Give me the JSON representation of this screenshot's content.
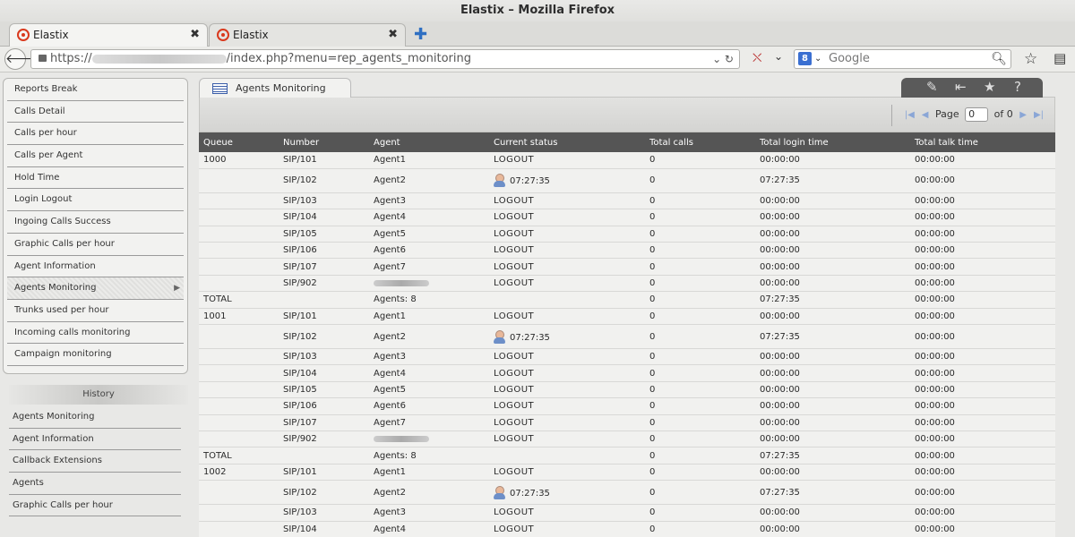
{
  "window": {
    "title": "Elastix – Mozilla Firefox"
  },
  "tabs": [
    {
      "label": "Elastix"
    },
    {
      "label": "Elastix"
    }
  ],
  "navbar": {
    "url_prefix": "https://",
    "url_suffix": "/index.php?menu=rep_agents_monitoring",
    "search_placeholder": "Google",
    "search_engine_letter": "8"
  },
  "sidebar": {
    "items": [
      {
        "label": "Reports Break"
      },
      {
        "label": "Calls Detail"
      },
      {
        "label": "Calls per hour"
      },
      {
        "label": "Calls per Agent"
      },
      {
        "label": "Hold Time"
      },
      {
        "label": "Login Logout"
      },
      {
        "label": "Ingoing Calls Success"
      },
      {
        "label": "Graphic Calls per hour"
      },
      {
        "label": "Agent Information"
      },
      {
        "label": "Agents Monitoring"
      },
      {
        "label": "Trunks used per hour"
      },
      {
        "label": "Incoming calls monitoring"
      },
      {
        "label": "Campaign monitoring"
      }
    ],
    "active_index": 9
  },
  "history": {
    "title": "History",
    "items": [
      {
        "label": "Agents Monitoring"
      },
      {
        "label": "Agent Information"
      },
      {
        "label": "Callback Extensions"
      },
      {
        "label": "Agents"
      },
      {
        "label": "Graphic Calls per hour"
      }
    ]
  },
  "page": {
    "tab_title": "Agents Monitoring",
    "pager": {
      "page_label": "Page",
      "page_value": "0",
      "of_label": "of 0"
    }
  },
  "table": {
    "columns": [
      "Queue",
      "Number",
      "Agent",
      "Current status",
      "Total calls",
      "Total login time",
      "Total talk time"
    ],
    "rows": [
      [
        "1000",
        "SIP/101",
        "Agent1",
        "LOGOUT",
        "0",
        "00:00:00",
        "00:00:00"
      ],
      [
        "",
        "SIP/102",
        "Agent2",
        "07:27:35",
        "0",
        "07:27:35",
        "00:00:00"
      ],
      [
        "",
        "SIP/103",
        "Agent3",
        "LOGOUT",
        "0",
        "00:00:00",
        "00:00:00"
      ],
      [
        "",
        "SIP/104",
        "Agent4",
        "LOGOUT",
        "0",
        "00:00:00",
        "00:00:00"
      ],
      [
        "",
        "SIP/105",
        "Agent5",
        "LOGOUT",
        "0",
        "00:00:00",
        "00:00:00"
      ],
      [
        "",
        "SIP/106",
        "Agent6",
        "LOGOUT",
        "0",
        "00:00:00",
        "00:00:00"
      ],
      [
        "",
        "SIP/107",
        "Agent7",
        "LOGOUT",
        "0",
        "00:00:00",
        "00:00:00"
      ],
      [
        "",
        "SIP/902",
        "",
        "LOGOUT",
        "0",
        "00:00:00",
        "00:00:00"
      ],
      [
        "TOTAL",
        "",
        "Agents: 8",
        "",
        "0",
        "07:27:35",
        "00:00:00"
      ],
      [
        "1001",
        "SIP/101",
        "Agent1",
        "LOGOUT",
        "0",
        "00:00:00",
        "00:00:00"
      ],
      [
        "",
        "SIP/102",
        "Agent2",
        "07:27:35",
        "0",
        "07:27:35",
        "00:00:00"
      ],
      [
        "",
        "SIP/103",
        "Agent3",
        "LOGOUT",
        "0",
        "00:00:00",
        "00:00:00"
      ],
      [
        "",
        "SIP/104",
        "Agent4",
        "LOGOUT",
        "0",
        "00:00:00",
        "00:00:00"
      ],
      [
        "",
        "SIP/105",
        "Agent5",
        "LOGOUT",
        "0",
        "00:00:00",
        "00:00:00"
      ],
      [
        "",
        "SIP/106",
        "Agent6",
        "LOGOUT",
        "0",
        "00:00:00",
        "00:00:00"
      ],
      [
        "",
        "SIP/107",
        "Agent7",
        "LOGOUT",
        "0",
        "00:00:00",
        "00:00:00"
      ],
      [
        "",
        "SIP/902",
        "",
        "LOGOUT",
        "0",
        "00:00:00",
        "00:00:00"
      ],
      [
        "TOTAL",
        "",
        "Agents: 8",
        "",
        "0",
        "07:27:35",
        "00:00:00"
      ],
      [
        "1002",
        "SIP/101",
        "Agent1",
        "LOGOUT",
        "0",
        "00:00:00",
        "00:00:00"
      ],
      [
        "",
        "SIP/102",
        "Agent2",
        "07:27:35",
        "0",
        "07:27:35",
        "00:00:00"
      ],
      [
        "",
        "SIP/103",
        "Agent3",
        "LOGOUT",
        "0",
        "00:00:00",
        "00:00:00"
      ],
      [
        "",
        "SIP/104",
        "Agent4",
        "LOGOUT",
        "0",
        "00:00:00",
        "00:00:00"
      ]
    ]
  }
}
